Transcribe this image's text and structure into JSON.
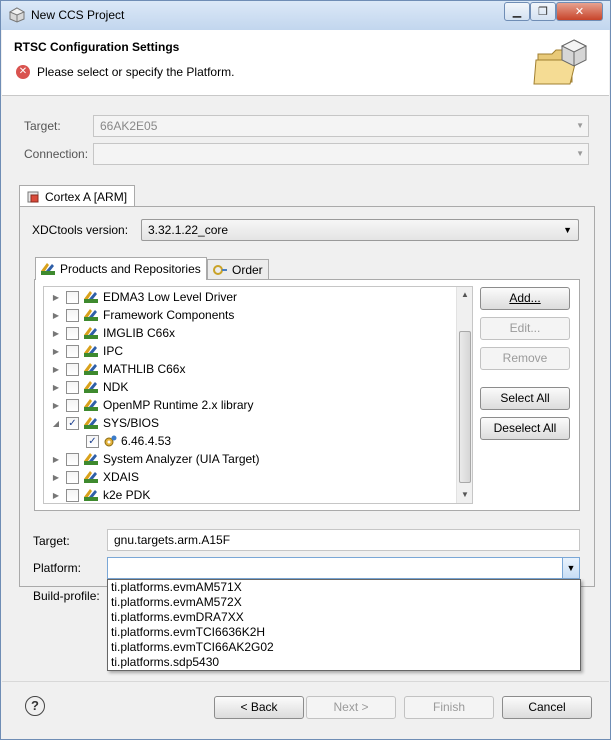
{
  "window": {
    "title": "New CCS Project"
  },
  "header": {
    "title": "RTSC Configuration Settings",
    "message": "Please select or specify the Platform."
  },
  "target_row": {
    "label": "Target:",
    "value": "66AK2E05"
  },
  "connection_row": {
    "label": "Connection:",
    "value": ""
  },
  "core_tab": {
    "label": "Cortex A [ARM]"
  },
  "xdctools": {
    "label": "XDCtools version:",
    "value": "3.32.1.22_core"
  },
  "inner_tabs": [
    {
      "label": "Products and Repositories"
    },
    {
      "label": "Order"
    }
  ],
  "tree": {
    "items": [
      {
        "label": "EDMA3 Low Level Driver",
        "checked": false,
        "expanded": false
      },
      {
        "label": "Framework Components",
        "checked": false,
        "expanded": false
      },
      {
        "label": "IMGLIB C66x",
        "checked": false,
        "expanded": false
      },
      {
        "label": "IPC",
        "checked": false,
        "expanded": false
      },
      {
        "label": "MATHLIB C66x",
        "checked": false,
        "expanded": false
      },
      {
        "label": "NDK",
        "checked": false,
        "expanded": false
      },
      {
        "label": "OpenMP Runtime 2.x library",
        "checked": false,
        "expanded": false
      },
      {
        "label": "SYS/BIOS",
        "checked": true,
        "expanded": true
      },
      {
        "label": "6.46.4.53",
        "checked": true,
        "child": true
      },
      {
        "label": "System Analyzer (UIA Target)",
        "checked": false,
        "expanded": false
      },
      {
        "label": "XDAIS",
        "checked": false,
        "expanded": false
      },
      {
        "label": "k2e PDK",
        "checked": false,
        "expanded": false
      }
    ]
  },
  "buttons": {
    "add": "Add...",
    "edit": "Edit...",
    "remove": "Remove",
    "select_all": "Select All",
    "deselect_all": "Deselect All",
    "back": "< Back",
    "next": "Next >",
    "finish": "Finish",
    "cancel": "Cancel"
  },
  "rtsc_target": {
    "label": "Target:",
    "value": "gnu.targets.arm.A15F"
  },
  "platform": {
    "label": "Platform:",
    "value": ""
  },
  "build_profile": {
    "label": "Build-profile:"
  },
  "platform_options": [
    "ti.platforms.evmAM571X",
    "ti.platforms.evmAM572X",
    "ti.platforms.evmDRA7XX",
    "ti.platforms.evmTCI6636K2H",
    "ti.platforms.evmTCI66AK2G02",
    "ti.platforms.sdp5430"
  ],
  "colors": {
    "error": "#d9534f",
    "accent": "#7aa7d6",
    "window_frame": "#6f8db5"
  }
}
